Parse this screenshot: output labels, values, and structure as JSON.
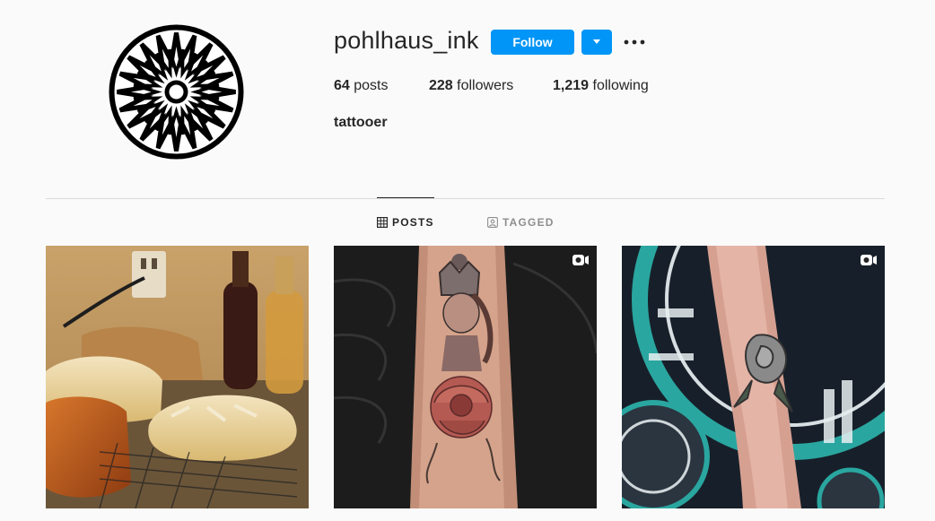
{
  "profile": {
    "username": "pohlhaus_ink",
    "follow_label": "Follow",
    "bio": "tattooer"
  },
  "stats": {
    "posts_count": "64",
    "posts_label": "posts",
    "followers_count": "228",
    "followers_label": "followers",
    "following_count": "1,219",
    "following_label": "following"
  },
  "tabs": [
    {
      "label": "POSTS",
      "icon": "grid-icon",
      "active": true
    },
    {
      "label": "TAGGED",
      "icon": "tagged-icon",
      "active": false
    }
  ],
  "posts": [
    {
      "subject": "bread",
      "is_video": false
    },
    {
      "subject": "queen-tattoo",
      "is_video": true
    },
    {
      "subject": "rose-tattoo",
      "is_video": true
    }
  ],
  "colors": {
    "accent": "#0095f6",
    "text": "#262626",
    "muted": "#8e8e8e",
    "background": "#fafafa",
    "divider": "#dbdbdb"
  }
}
